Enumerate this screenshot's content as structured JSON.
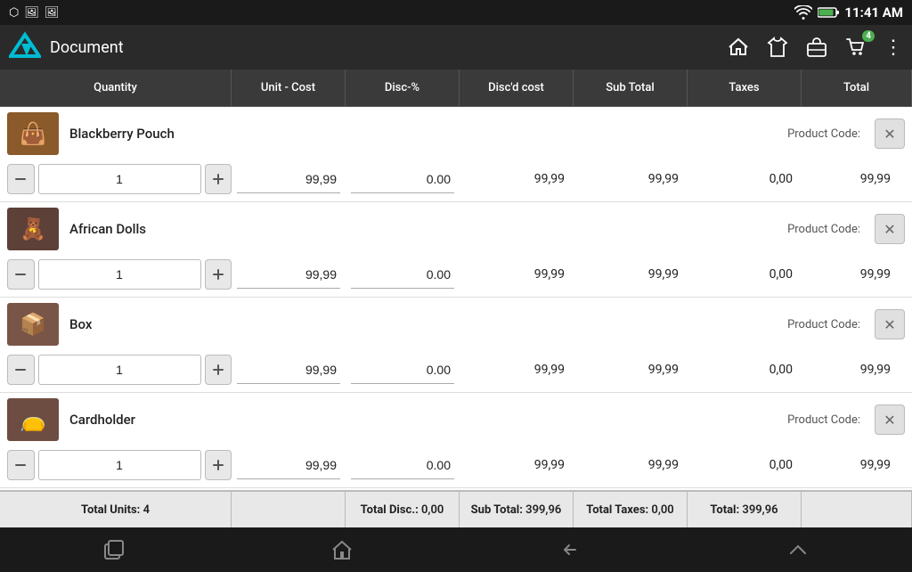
{
  "statusBar": {
    "time": "11:41 AM",
    "batteryIcon": "battery-icon",
    "wifiIcon": "wifi-icon",
    "usbIcon": "usb-icon"
  },
  "navBar": {
    "title": "Document",
    "homeIcon": "home-icon",
    "shirtIcon": "shirt-icon",
    "briefcaseIcon": "briefcase-icon",
    "cartIcon": "cart-icon",
    "cartBadge": "4",
    "moreIcon": "more-icon"
  },
  "columns": [
    {
      "key": "quantity",
      "label": "Quantity"
    },
    {
      "key": "unitCost",
      "label": "Unit - Cost"
    },
    {
      "key": "discPct",
      "label": "Disc-%"
    },
    {
      "key": "discCost",
      "label": "Disc'd cost"
    },
    {
      "key": "subTotal",
      "label": "Sub Total"
    },
    {
      "key": "taxes",
      "label": "Taxes"
    },
    {
      "key": "total",
      "label": "Total"
    }
  ],
  "products": [
    {
      "id": 1,
      "name": "Blackberry Pouch",
      "productCodeLabel": "Product Code:",
      "productCode": "",
      "thumb": "👜",
      "thumbColor": "#8B5A2B",
      "qty": "1",
      "unitCost": "99,99",
      "discPct": "0.00",
      "discCost": "99,99",
      "subTotal": "99,99",
      "taxes": "0,00",
      "total": "99,99"
    },
    {
      "id": 2,
      "name": "African Dolls",
      "productCodeLabel": "Product Code:",
      "productCode": "",
      "thumb": "🪆",
      "thumbColor": "#5D4037",
      "qty": "1",
      "unitCost": "99,99",
      "discPct": "0.00",
      "discCost": "99,99",
      "subTotal": "99,99",
      "taxes": "0,00",
      "total": "99,99"
    },
    {
      "id": 3,
      "name": "Box",
      "productCodeLabel": "Product Code:",
      "productCode": "",
      "thumb": "📦",
      "thumbColor": "#795548",
      "qty": "1",
      "unitCost": "99,99",
      "discPct": "0.00",
      "discCost": "99,99",
      "subTotal": "99,99",
      "taxes": "0,00",
      "total": "99,99"
    },
    {
      "id": 4,
      "name": "Cardholder",
      "productCodeLabel": "Product Code:",
      "productCode": "",
      "thumb": "👝",
      "thumbColor": "#6D4C41",
      "qty": "1",
      "unitCost": "99,99",
      "discPct": "0.00",
      "discCost": "99,99",
      "subTotal": "99,99",
      "taxes": "0,00",
      "total": "99,99"
    }
  ],
  "footer": {
    "totalUnitsLabel": "Total Units:",
    "totalUnitsValue": "4",
    "totalDiscLabel": "Total Disc.:",
    "totalDiscValue": "0,00",
    "subTotalLabel": "Sub Total:",
    "subTotalValue": "399,96",
    "totalTaxesLabel": "Total Taxes:",
    "totalTaxesValue": "0,00",
    "totalLabel": "Total:",
    "totalValue": "399,96"
  },
  "bottomNav": {
    "squareIcon": "square-icon",
    "homeIcon": "bottom-home-icon",
    "backIcon": "back-icon",
    "upIcon": "up-icon"
  }
}
